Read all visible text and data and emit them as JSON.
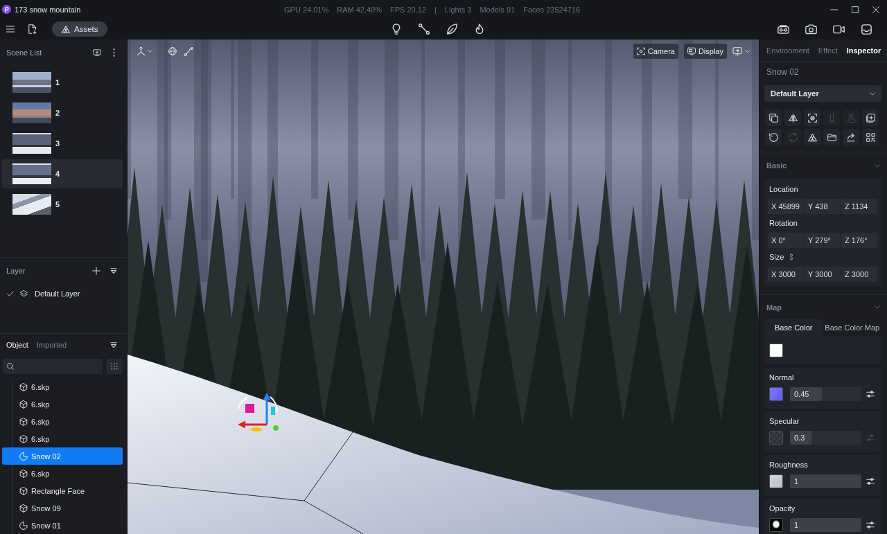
{
  "window": {
    "title": "173 snow mountain",
    "stats": [
      "GPU 24.01%",
      "RAM 42.40%",
      "FPS 20.12",
      "|",
      "Lights 3",
      "Models 91",
      "Faces 22524716"
    ]
  },
  "toolbar": {
    "assets_button": "Assets"
  },
  "scene_list": {
    "title": "Scene List",
    "scenes": [
      {
        "label": "1",
        "selected": false
      },
      {
        "label": "2",
        "selected": false
      },
      {
        "label": "3",
        "selected": false
      },
      {
        "label": "4",
        "selected": true
      },
      {
        "label": "5",
        "selected": false
      }
    ]
  },
  "layers": {
    "title": "Layer",
    "items": [
      {
        "name": "Default Layer",
        "checked": true
      }
    ]
  },
  "objects": {
    "tabs": [
      {
        "label": "Object",
        "selected": true
      },
      {
        "label": "Imported",
        "selected": false
      }
    ],
    "items": [
      {
        "name": "6.skp",
        "kind": "model",
        "selected": false
      },
      {
        "name": "6.skp",
        "kind": "model",
        "selected": false
      },
      {
        "name": "6.skp",
        "kind": "model",
        "selected": false
      },
      {
        "name": "6.skp",
        "kind": "model",
        "selected": false
      },
      {
        "name": "Snow 02",
        "kind": "surface",
        "selected": true
      },
      {
        "name": "6.skp",
        "kind": "model",
        "selected": false
      },
      {
        "name": "Rectangle Face",
        "kind": "model",
        "selected": false
      },
      {
        "name": "Snow 09",
        "kind": "model",
        "selected": false
      },
      {
        "name": "Snow 01",
        "kind": "surface",
        "selected": false
      }
    ]
  },
  "viewport": {
    "camera_button": "Camera",
    "display_button": "Display"
  },
  "inspector": {
    "tabs": [
      {
        "label": "Environment",
        "selected": false
      },
      {
        "label": "Effect",
        "selected": false
      },
      {
        "label": "Inspector",
        "selected": true
      }
    ],
    "object_name": "Snow 02",
    "layer_select": "Default Layer",
    "actions": [
      {
        "kind": "copy",
        "disabled": false
      },
      {
        "kind": "mirror",
        "disabled": false
      },
      {
        "kind": "target",
        "disabled": false
      },
      {
        "kind": "pillar",
        "disabled": true
      },
      {
        "kind": "person",
        "disabled": true
      },
      {
        "kind": "add",
        "disabled": false
      },
      {
        "kind": "rotate",
        "disabled": false
      },
      {
        "kind": "refresh",
        "disabled": true
      },
      {
        "kind": "triangle",
        "disabled": false
      },
      {
        "kind": "folder",
        "disabled": false
      },
      {
        "kind": "share",
        "disabled": false
      },
      {
        "kind": "qr-code",
        "disabled": false
      }
    ],
    "basic": {
      "title": "Basic",
      "expanded": true,
      "groups": [
        {
          "label": "Location",
          "linked": false,
          "fields": [
            "X 45899",
            "Y 438",
            "Z 1134"
          ]
        },
        {
          "label": "Rotation",
          "linked": false,
          "fields": [
            "X 0°",
            "Y 279°",
            "Z 176°"
          ]
        },
        {
          "label": "Size",
          "linked": true,
          "fields": [
            "X 3000",
            "Y 3000",
            "Z 3000"
          ]
        }
      ]
    },
    "map": {
      "title": "Map",
      "expanded": true,
      "tabs": [
        {
          "label": "Base Color",
          "selected": true
        },
        {
          "label": "Base Color Map",
          "selected": false
        }
      ],
      "base_color": {
        "color": "#ffffff"
      },
      "channels": [
        {
          "name": "Normal",
          "kind": "normal",
          "value": "0.45",
          "level": 0.45,
          "adjust_disabled": false
        },
        {
          "name": "Specular",
          "kind": "checker",
          "value": "0.3",
          "level": 0.3,
          "adjust_disabled": true
        },
        {
          "name": "Roughness",
          "kind": "grey",
          "value": "1",
          "level": 1,
          "adjust_disabled": false
        },
        {
          "name": "Opacity",
          "kind": "mask",
          "value": "1",
          "level": 1,
          "adjust_disabled": false
        }
      ]
    }
  }
}
